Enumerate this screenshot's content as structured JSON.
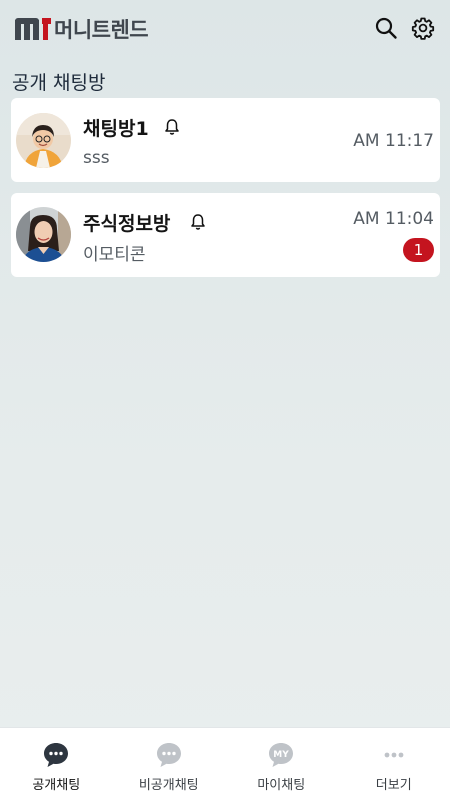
{
  "app": {
    "title": "머니트렌드"
  },
  "section": {
    "title": "공개 채팅방"
  },
  "rooms": [
    {
      "name": "채팅방1",
      "time": "AM 11:17",
      "last_message": "sss",
      "unread": ""
    },
    {
      "name": "주식정보방",
      "time": "AM 11:04",
      "last_message": "이모티콘",
      "unread": "1"
    }
  ],
  "nav": {
    "items": [
      {
        "label": "공개채팅",
        "icon": "chat-bubble-icon",
        "active": true
      },
      {
        "label": "비공개채팅",
        "icon": "chat-bubble-icon",
        "active": false
      },
      {
        "label": "마이채팅",
        "icon": "my-bubble-icon",
        "icon_text": "MY",
        "active": false
      },
      {
        "label": "더보기",
        "icon": "more-dots-icon",
        "active": false
      }
    ]
  },
  "colors": {
    "brand_red": "#c4141f",
    "brand_gray": "#3f464e",
    "background": "#dde6e7"
  }
}
